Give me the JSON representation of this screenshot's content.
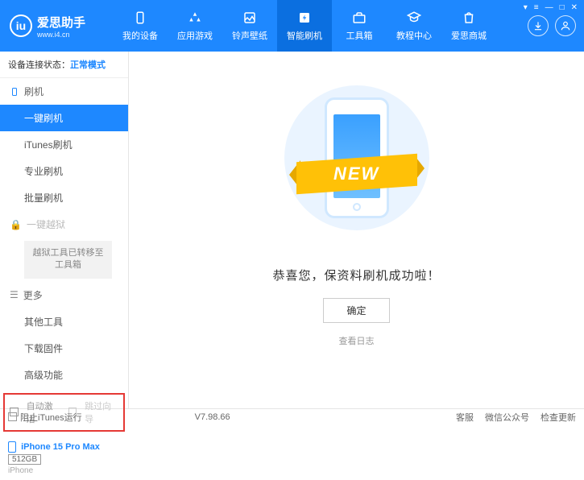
{
  "app": {
    "title": "爱思助手",
    "subtitle": "www.i4.cn"
  },
  "nav": {
    "items": [
      {
        "label": "我的设备"
      },
      {
        "label": "应用游戏"
      },
      {
        "label": "铃声壁纸"
      },
      {
        "label": "智能刷机"
      },
      {
        "label": "工具箱"
      },
      {
        "label": "教程中心"
      },
      {
        "label": "爱思商城"
      }
    ],
    "active_index": 3
  },
  "status": {
    "label": "设备连接状态：",
    "value": "正常模式"
  },
  "sidebar": {
    "section_flash": "刷机",
    "items_flash": [
      "一键刷机",
      "iTunes刷机",
      "专业刷机",
      "批量刷机"
    ],
    "section_jailbreak": "一键越狱",
    "jailbreak_note": "越狱工具已转移至工具箱",
    "section_more": "更多",
    "items_more": [
      "其他工具",
      "下载固件",
      "高级功能"
    ],
    "checks": {
      "auto_activate": "自动激活",
      "skip_guide": "跳过向导"
    },
    "device": {
      "name": "iPhone 15 Pro Max",
      "storage": "512GB",
      "type": "iPhone"
    }
  },
  "main": {
    "new_badge": "NEW",
    "success": "恭喜您，保资料刷机成功啦！",
    "ok": "确定",
    "view_log": "查看日志"
  },
  "footer": {
    "block_itunes": "阻止iTunes运行",
    "version": "V7.98.66",
    "links": [
      "客服",
      "微信公众号",
      "检查更新"
    ]
  }
}
